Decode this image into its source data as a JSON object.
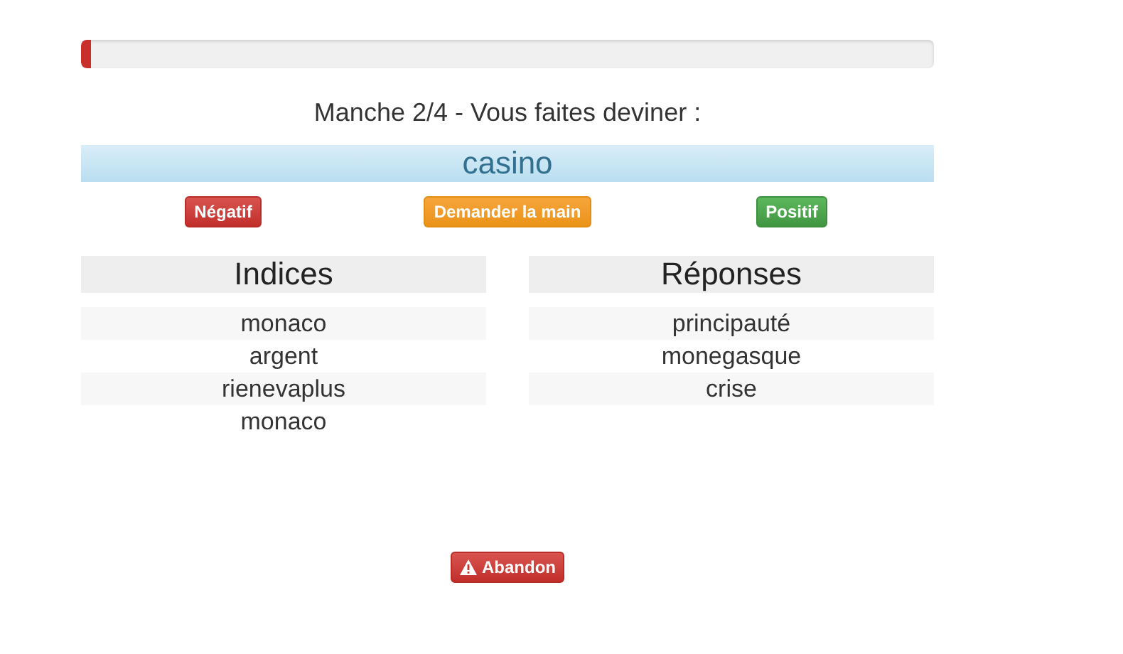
{
  "progress": {
    "level": 0.012
  },
  "round_title": "Manche 2/4 - Vous faites deviner :",
  "word": "casino",
  "actions": [
    {
      "label": "Négatif",
      "kind": "danger"
    },
    {
      "label": "Demander la main",
      "kind": "warning"
    },
    {
      "label": "Positif",
      "kind": "success"
    }
  ],
  "columns": [
    {
      "title": "Indices",
      "items": [
        "monaco",
        "argent",
        "rienevaplus",
        "monaco"
      ]
    },
    {
      "title": "Réponses",
      "items": [
        "principauté",
        "monegasque",
        "crise"
      ]
    }
  ],
  "abandon_button": {
    "label": "Abandon"
  }
}
